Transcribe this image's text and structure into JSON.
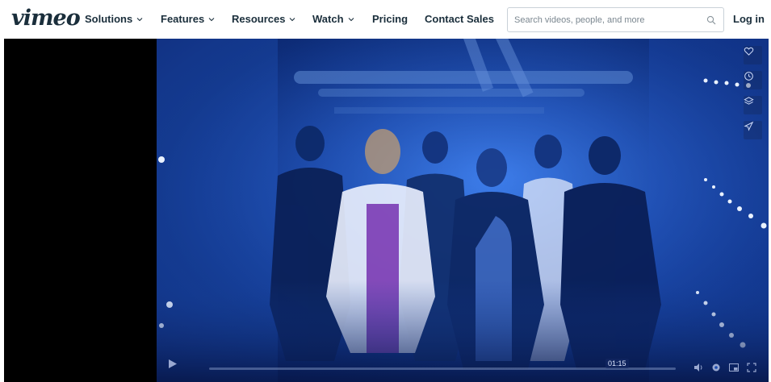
{
  "brand": {
    "logo_text": "vimeo"
  },
  "nav": {
    "items": [
      {
        "label": "Solutions",
        "dropdown": true
      },
      {
        "label": "Features",
        "dropdown": true
      },
      {
        "label": "Resources",
        "dropdown": true
      },
      {
        "label": "Watch",
        "dropdown": true
      },
      {
        "label": "Pricing",
        "dropdown": false
      },
      {
        "label": "Contact Sales",
        "dropdown": false
      }
    ]
  },
  "search": {
    "placeholder": "Search videos, people, and more",
    "value": ""
  },
  "auth": {
    "login_label": "Log in"
  },
  "player": {
    "current_time": "01:15",
    "progress_fraction": 0.0,
    "side_actions": [
      "heart-icon",
      "clock-icon",
      "layers-icon",
      "send-icon"
    ],
    "controls": [
      "play-icon",
      "volume-icon",
      "settings-icon",
      "pip-icon",
      "fullscreen-icon"
    ]
  },
  "colors": {
    "text": "#1a2e3b",
    "video_tint": "#1a4bb0",
    "border": "#c9d1d8"
  }
}
